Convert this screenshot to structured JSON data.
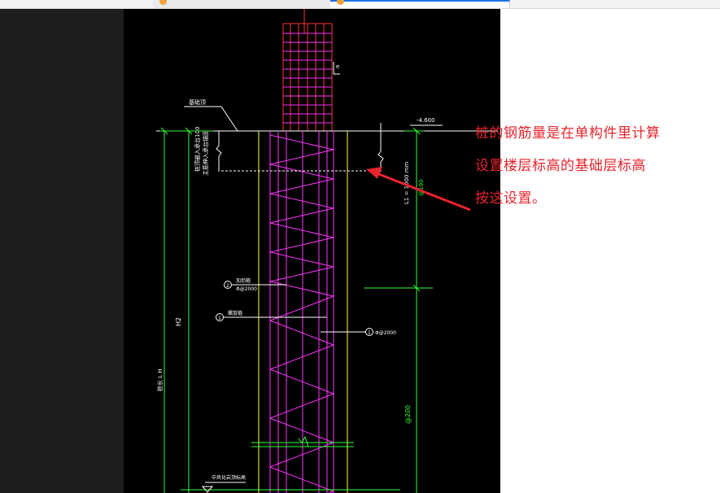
{
  "colors": {
    "canvas_bg": "#000000",
    "outline": "#ffff33",
    "stirrup": "#ff33ff",
    "column_rebar": "#ff3333",
    "dimension": "#33ff33",
    "leader": "#ffffff",
    "annotation": "#e8242c"
  },
  "browser": {
    "tab_icons": [
      "tab-favicon",
      "tab-favicon"
    ]
  },
  "drawing": {
    "elevation": "-4.600",
    "label_top_left": "基础顶",
    "label_vertical_a": "桩顶嵌入承台100",
    "label_vertical_b": "主筋伸入承台锚固",
    "dim_right_top": "L1 = 1000 mm",
    "dim_right_circle": "@100",
    "callout_2_number": "2",
    "callout_2_text": "加劲箍",
    "callout_2_spec": "Φ@2000",
    "callout_1_number": "1",
    "callout_1_text": "螺旋箍",
    "callout_right_number": "1",
    "callout_right_spec": "Φ@2000",
    "dim_h2": "H2",
    "dim_left_vertical": "桩长 L H",
    "dim_right_lower": "@200",
    "bottom_label": "中风化岩顶标高",
    "top_tick_label": "e"
  },
  "annotation": {
    "line1": "桩的钢筋量是在单构件里计算",
    "line2": "设置楼层标高的基础层标高",
    "line3": "按这设置。"
  }
}
